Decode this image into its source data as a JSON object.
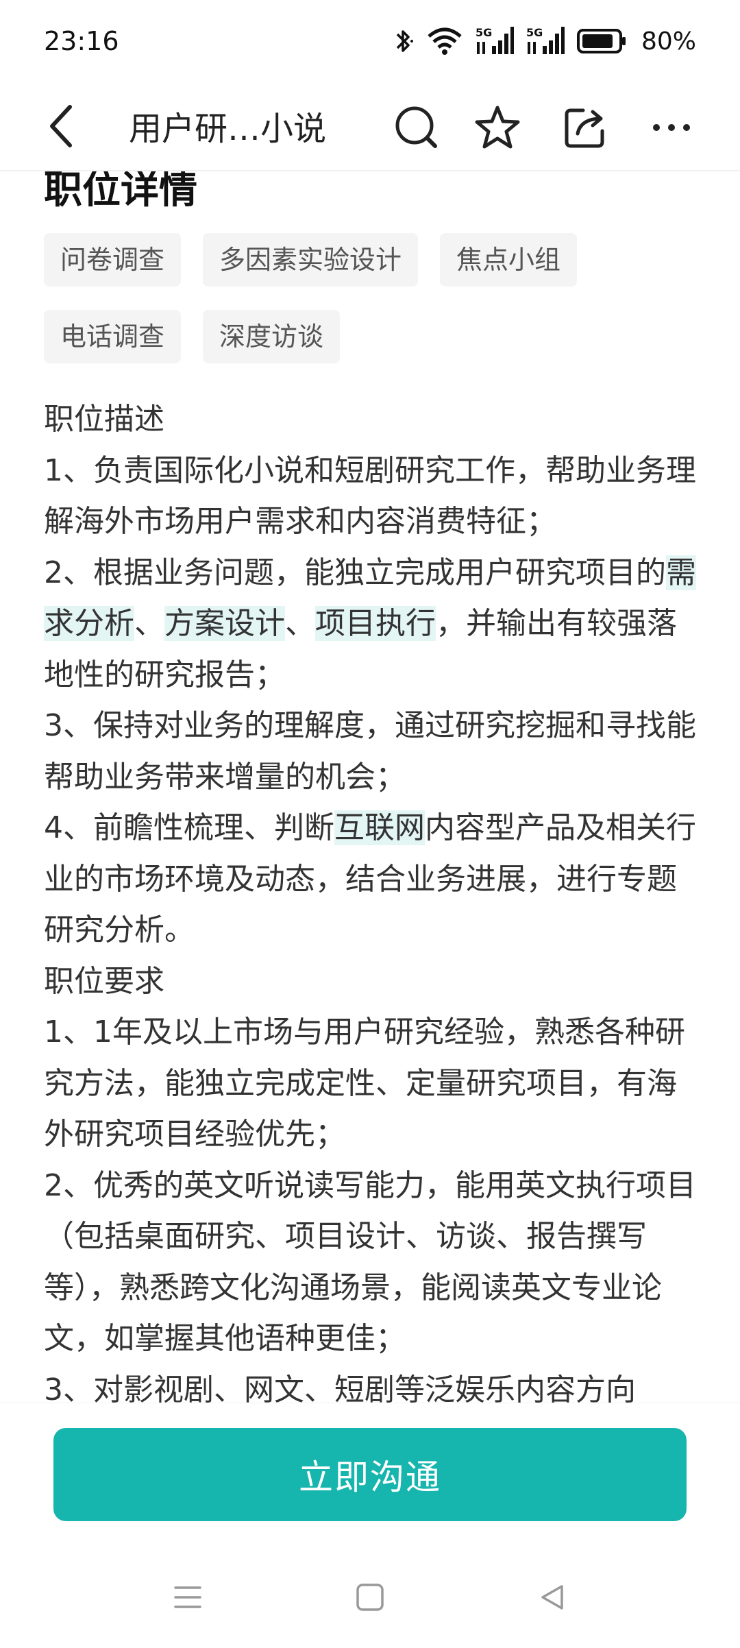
{
  "status": {
    "time": "23:16",
    "battery": "80%",
    "network1": "5G",
    "network2": "5G"
  },
  "nav": {
    "title": "用户研…小说"
  },
  "section": {
    "title": "职位详情"
  },
  "tags": [
    "问卷调查",
    "多因素实验设计",
    "焦点小组",
    "电话调查",
    "深度访谈"
  ],
  "description": {
    "heading1": "职位描述",
    "line1": "1、负责国际化小说和短剧研究工作，帮助业务理解海外市场用户需求和内容消费特征；",
    "line2_a": "2、根据业务问题，能独立完成用户研究项目的",
    "line2_hl1": "需求分析",
    "line2_sep1": "、",
    "line2_hl2": "方案设计",
    "line2_sep2": "、",
    "line2_hl3": "项目执行",
    "line2_b": "，并输出有较强落地性的研究报告；",
    "line3": "3、保持对业务的理解度，通过研究挖掘和寻找能帮助业务带来增量的机会；",
    "line4_a": "4、前瞻性梳理、判断",
    "line4_hl": "互联网",
    "line4_b": "内容型产品及相关行业的市场环境及动态，结合业务进展，进行专题研究分析。",
    "heading2": "职位要求",
    "req1": "1、1年及以上市场与用户研究经验，熟悉各种研究方法，能独立完成定性、定量研究项目，有海外研究项目经验优先；",
    "req2": "2、优秀的英文听说读写能力，能用英文执行项目（包括桌面研究、项目设计、访谈、报告撰写等），熟悉跨文化沟通场景，能阅读英文专业论文，如掌握其他语种更佳；",
    "req3": "3、对影视剧、网文、短剧等泛娱乐内容方向"
  },
  "action": {
    "chat_label": "立即沟通"
  },
  "colors": {
    "accent": "#16b5ad",
    "highlight": "#e3f6f4",
    "tag_bg": "#f4f4f4"
  }
}
